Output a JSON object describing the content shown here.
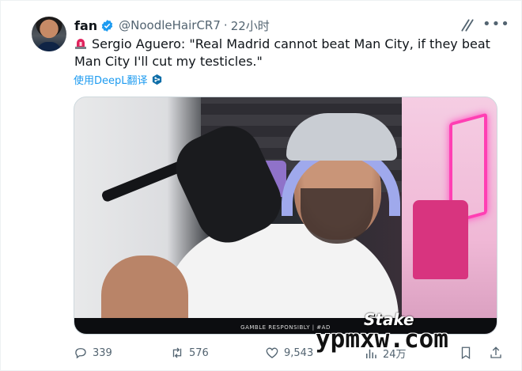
{
  "post": {
    "display_name": "fan",
    "handle": "@NoodleHairCR7",
    "separator": "·",
    "time": "22小时",
    "text": "Sergio Aguero: \"Real Madrid cannot beat Man City, if they beat Man City I'll cut my testicles.\"",
    "translate_label": "使用DeepL翻译"
  },
  "media": {
    "banner_text": "GAMBLE RESPONSIBLY | #AD",
    "stake_logo": "Stake"
  },
  "actions": {
    "replies": "339",
    "retweets": "576",
    "likes": "9,543",
    "views": "24万"
  },
  "watermark": "ypmxw.com",
  "icons": {
    "verified": "verified-badge-icon",
    "siren": "siren-emoji-icon",
    "grok": "grok-icon",
    "more": "more-options-icon",
    "translate": "deepl-icon",
    "reply": "reply-icon",
    "retweet": "retweet-icon",
    "like": "heart-icon",
    "views": "views-icon",
    "bookmark": "bookmark-icon",
    "share": "share-icon"
  },
  "colors": {
    "accent": "#1d9bf0",
    "muted": "#536471",
    "siren": "#e0245e"
  }
}
